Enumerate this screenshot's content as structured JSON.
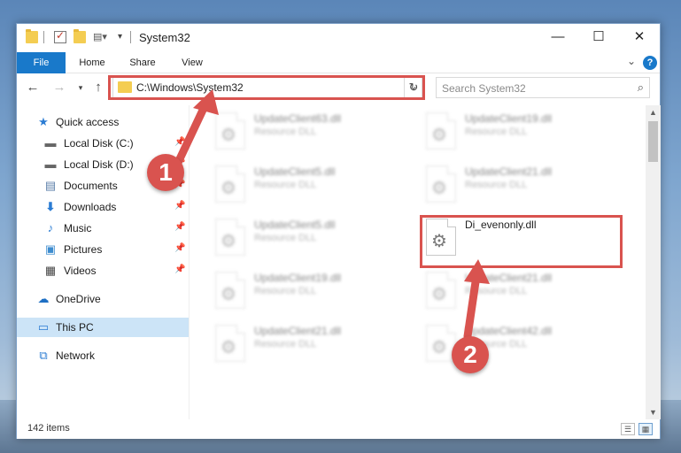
{
  "window": {
    "title": "System32"
  },
  "ribbon": {
    "tabs": [
      {
        "label": "File"
      },
      {
        "label": "Home"
      },
      {
        "label": "Share"
      },
      {
        "label": "View"
      }
    ],
    "help_label": "?"
  },
  "nav": {
    "address": "C:\\Windows\\System32",
    "search_placeholder": "Search System32"
  },
  "sidebar": {
    "items": [
      {
        "label": "Quick access",
        "icon": "star-icon"
      },
      {
        "label": "Local Disk (C:)",
        "icon": "drive-icon",
        "pinned": true
      },
      {
        "label": "Local Disk (D:)",
        "icon": "drive-icon",
        "pinned": true
      },
      {
        "label": "Documents",
        "icon": "documents-icon",
        "pinned": true
      },
      {
        "label": "Downloads",
        "icon": "download-icon",
        "pinned": true
      },
      {
        "label": "Music",
        "icon": "music-icon",
        "pinned": true
      },
      {
        "label": "Pictures",
        "icon": "pictures-icon",
        "pinned": true
      },
      {
        "label": "Videos",
        "icon": "videos-icon",
        "pinned": true
      },
      {
        "label": "OneDrive",
        "icon": "cloud-icon"
      },
      {
        "label": "This PC",
        "icon": "computer-icon",
        "selected": true
      },
      {
        "label": "Network",
        "icon": "network-icon"
      }
    ]
  },
  "files": [
    {
      "name": "UpdateClient63.dll",
      "type": "Resource DLL",
      "blurred": true
    },
    {
      "name": "UpdateClient19.dll",
      "type": "Resource DLL",
      "blurred": true
    },
    {
      "name": "UpdateClient5.dll",
      "type": "Resource DLL",
      "blurred": true
    },
    {
      "name": "UpdateClient21.dll",
      "type": "Resource DLL",
      "blurred": true
    },
    {
      "name": "UpdateClient5.dll",
      "type": "Resource DLL",
      "blurred": true
    },
    {
      "name": "Di_evenonly.dll",
      "type": "",
      "blurred": false,
      "highlighted": true
    },
    {
      "name": "UpdateClient19.dll",
      "type": "Resource DLL",
      "blurred": true
    },
    {
      "name": "UpdateClient21.dll",
      "type": "Resource DLL",
      "blurred": true
    },
    {
      "name": "UpdateClient21.dll",
      "type": "Resource DLL",
      "blurred": true
    },
    {
      "name": "UpdateClient42.dll",
      "type": "Resource DLL",
      "blurred": true
    }
  ],
  "status": {
    "item_count": "142 items"
  },
  "annotations": {
    "step1": "1",
    "step2": "2",
    "color": "#d9534f"
  }
}
